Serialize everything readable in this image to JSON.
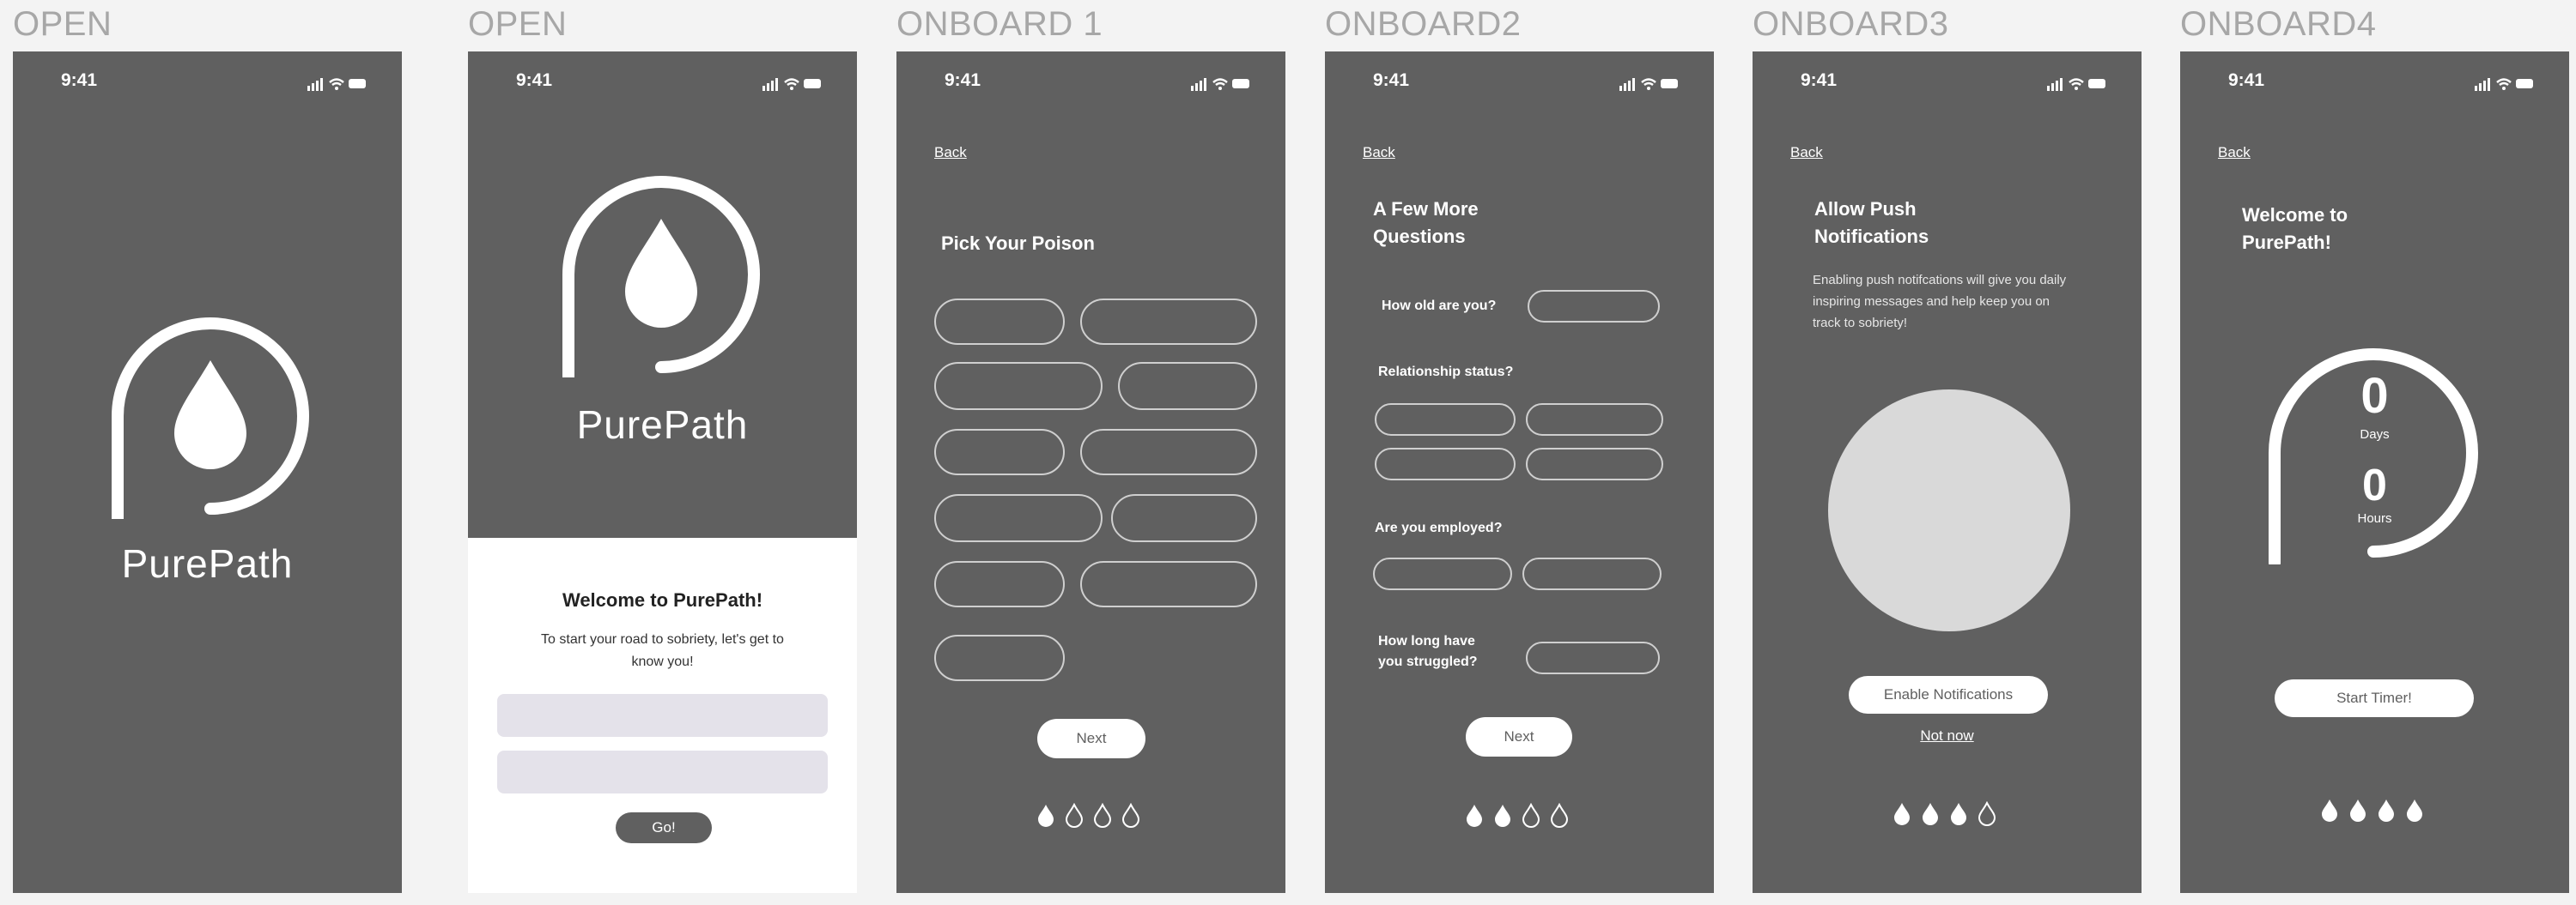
{
  "status_time": "9:41",
  "frames": [
    {
      "title": "OPEN",
      "brand": "PurePath"
    },
    {
      "title": "OPEN",
      "brand": "PurePath",
      "welcome_title": "Welcome to PurePath!",
      "welcome_body": "To start your road to sobriety, let's get to know you!",
      "go_label": "Go!"
    },
    {
      "title": "ONBOARD 1",
      "back": "Back",
      "heading": "Pick Your Poison",
      "next": "Next"
    },
    {
      "title": "ONBOARD2",
      "back": "Back",
      "heading_line1": "A Few More",
      "heading_line2": "Questions",
      "q1": "How old are you?",
      "q2": "Relationship status?",
      "q3": "Are you employed?",
      "q4_line1": "How long have",
      "q4_line2": "you struggled?",
      "next": "Next"
    },
    {
      "title": "ONBOARD3",
      "back": "Back",
      "heading_line1": "Allow Push",
      "heading_line2": "Notifications",
      "body": "Enabling push notifcations will give you daily inspiring messages and help keep you on track to sobriety!",
      "enable": "Enable Notifications",
      "not_now": "Not now"
    },
    {
      "title": "ONBOARD4",
      "back": "Back",
      "heading_line1": "Welcome to",
      "heading_line2": "PurePath!",
      "days_value": "0",
      "days_label": "Days",
      "hours_value": "0",
      "hours_label": "Hours",
      "start": "Start Timer!"
    }
  ],
  "progress": {
    "onboard1": 1,
    "onboard2": 2,
    "onboard3": 3,
    "onboard4": 4,
    "total": 4
  },
  "colors": {
    "phone_bg": "#606060",
    "white": "#ffffff",
    "pill_border": "#cfcfcf",
    "input_fill": "#e4e2ea",
    "go_button": "#606060",
    "circle_placeholder": "#d9d9d9"
  }
}
